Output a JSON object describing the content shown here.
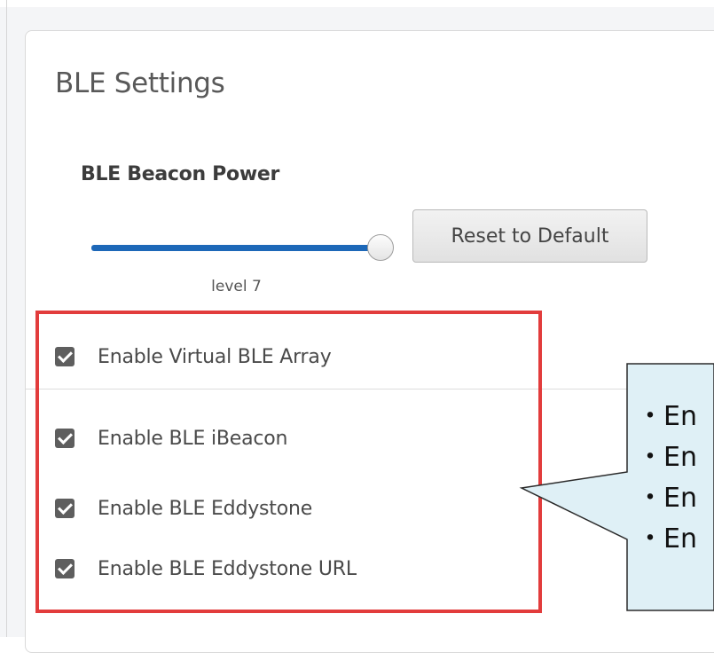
{
  "panel": {
    "title": "BLE Settings"
  },
  "beacon_power": {
    "label": "BLE Beacon Power",
    "value_text": "level 7",
    "level_fraction": 1.0,
    "reset_label": "Reset to Default"
  },
  "options": [
    {
      "label": "Enable Virtual BLE Array",
      "checked": true
    },
    {
      "label": "Enable BLE iBeacon",
      "checked": true
    },
    {
      "label": "Enable BLE Eddystone",
      "checked": true
    },
    {
      "label": "Enable BLE Eddystone URL",
      "checked": true
    }
  ],
  "callout": {
    "lines": [
      "・En",
      "・En",
      "・En",
      "・En"
    ]
  },
  "colors": {
    "slider_fill": "#1d68b8",
    "highlight": "#e23c3c",
    "callout_bg": "#dff0f6"
  }
}
